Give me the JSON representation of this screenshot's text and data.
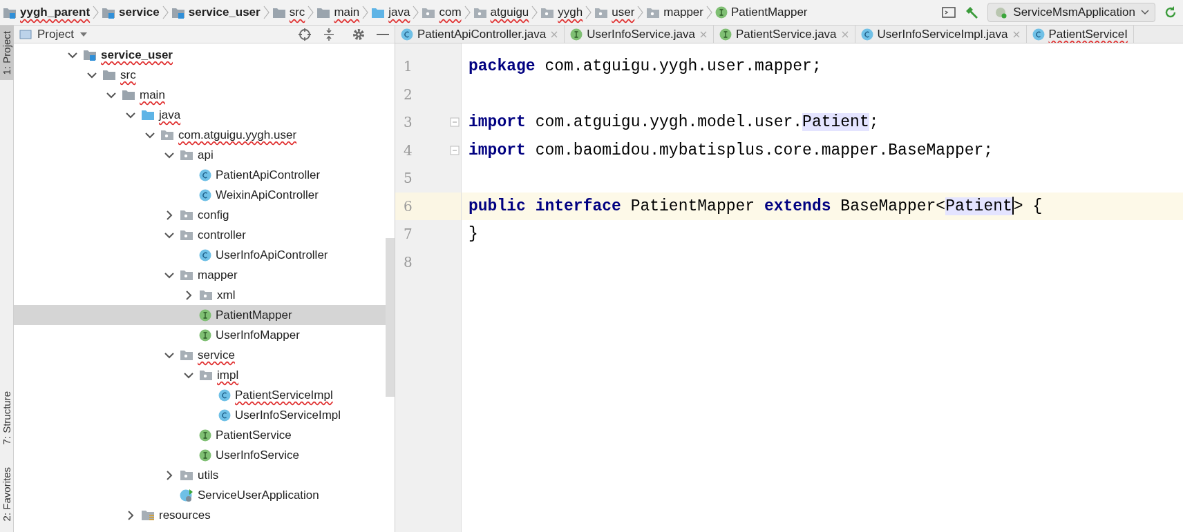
{
  "breadcrumbs": [
    {
      "label": "yygh_parent",
      "kind": "module",
      "spell_error": true
    },
    {
      "label": "service",
      "kind": "module",
      "spell_error": false
    },
    {
      "label": "service_user",
      "kind": "module",
      "spell_error": false
    },
    {
      "label": "src",
      "kind": "folder",
      "spell_error": true
    },
    {
      "label": "main",
      "kind": "folder",
      "spell_error": true
    },
    {
      "label": "java",
      "kind": "source",
      "spell_error": true
    },
    {
      "label": "com",
      "kind": "package",
      "spell_error": true
    },
    {
      "label": "atguigu",
      "kind": "package",
      "spell_error": true
    },
    {
      "label": "yygh",
      "kind": "package",
      "spell_error": true
    },
    {
      "label": "user",
      "kind": "package",
      "spell_error": true
    },
    {
      "label": "mapper",
      "kind": "package",
      "spell_error": false
    },
    {
      "label": "PatientMapper",
      "kind": "interface",
      "spell_error": false
    }
  ],
  "run_config": {
    "label": "ServiceMsmApplication"
  },
  "tool_stripe": [
    {
      "label": "1: Project",
      "selected": true
    },
    {
      "label": "7: Structure",
      "selected": false
    },
    {
      "label": "2: Favorites",
      "selected": false
    }
  ],
  "project_panel": {
    "title": "Project",
    "tree": [
      {
        "label": "service_user",
        "kind": "module",
        "bold": true,
        "spell_error": true,
        "expanded": true,
        "selected": false,
        "children": [
          {
            "label": "src",
            "kind": "folder",
            "spell_error": true,
            "expanded": true,
            "selected": false,
            "children": [
              {
                "label": "main",
                "kind": "folder",
                "spell_error": true,
                "expanded": true,
                "selected": false,
                "children": [
                  {
                    "label": "java",
                    "kind": "source",
                    "spell_error": true,
                    "expanded": true,
                    "selected": false,
                    "children": [
                      {
                        "label": "com.atguigu.yygh.user",
                        "kind": "package",
                        "spell_error": true,
                        "expanded": true,
                        "selected": false,
                        "children": [
                          {
                            "label": "api",
                            "kind": "package",
                            "spell_error": false,
                            "expanded": true,
                            "selected": false,
                            "children": [
                              {
                                "label": "PatientApiController",
                                "kind": "class",
                                "spell_error": false,
                                "selected": false
                              },
                              {
                                "label": "WeixinApiController",
                                "kind": "class",
                                "spell_error": false,
                                "selected": false
                              }
                            ]
                          },
                          {
                            "label": "config",
                            "kind": "package",
                            "spell_error": false,
                            "expanded": false,
                            "selected": false
                          },
                          {
                            "label": "controller",
                            "kind": "package",
                            "spell_error": false,
                            "expanded": true,
                            "selected": false,
                            "children": [
                              {
                                "label": "UserInfoApiController",
                                "kind": "class",
                                "spell_error": false,
                                "selected": false
                              }
                            ]
                          },
                          {
                            "label": "mapper",
                            "kind": "package",
                            "spell_error": false,
                            "expanded": true,
                            "selected": false,
                            "children": [
                              {
                                "label": "xml",
                                "kind": "package",
                                "spell_error": false,
                                "expanded": false,
                                "selected": false
                              },
                              {
                                "label": "PatientMapper",
                                "kind": "interface",
                                "spell_error": false,
                                "selected": true
                              },
                              {
                                "label": "UserInfoMapper",
                                "kind": "interface",
                                "spell_error": false,
                                "selected": false
                              }
                            ]
                          },
                          {
                            "label": "service",
                            "kind": "package",
                            "spell_error": true,
                            "expanded": true,
                            "selected": false,
                            "children": [
                              {
                                "label": "impl",
                                "kind": "package",
                                "spell_error": true,
                                "expanded": true,
                                "selected": false,
                                "children": [
                                  {
                                    "label": "PatientServiceImpl",
                                    "kind": "class",
                                    "spell_error": true,
                                    "selected": false
                                  },
                                  {
                                    "label": "UserInfoServiceImpl",
                                    "kind": "class",
                                    "spell_error": false,
                                    "selected": false
                                  }
                                ]
                              },
                              {
                                "label": "PatientService",
                                "kind": "interface",
                                "spell_error": false,
                                "selected": false
                              },
                              {
                                "label": "UserInfoService",
                                "kind": "interface",
                                "spell_error": false,
                                "selected": false
                              }
                            ]
                          },
                          {
                            "label": "utils",
                            "kind": "package",
                            "spell_error": false,
                            "expanded": false,
                            "selected": false
                          },
                          {
                            "label": "ServiceUserApplication",
                            "kind": "app",
                            "spell_error": false,
                            "selected": false
                          }
                        ]
                      }
                    ]
                  },
                  {
                    "label": "resources",
                    "kind": "resources",
                    "spell_error": false,
                    "expanded": false,
                    "selected": false
                  }
                ]
              }
            ]
          }
        ]
      }
    ]
  },
  "editor_tabs": [
    {
      "label": "PatientApiController.java",
      "kind": "class",
      "selected": false,
      "spell_error": false,
      "closable": true
    },
    {
      "label": "UserInfoService.java",
      "kind": "interface",
      "selected": false,
      "spell_error": false,
      "closable": true
    },
    {
      "label": "PatientService.java",
      "kind": "interface",
      "selected": false,
      "spell_error": false,
      "closable": true
    },
    {
      "label": "UserInfoServiceImpl.java",
      "kind": "class",
      "selected": false,
      "spell_error": false,
      "closable": true
    },
    {
      "label": "PatientServiceI",
      "kind": "class",
      "selected": false,
      "spell_error": true,
      "closable": false
    }
  ],
  "code_lines": [
    {
      "number": "1",
      "current": false,
      "fold": false,
      "tokens": [
        {
          "text": "package",
          "kind": "keyword"
        },
        {
          "text": " com.atguigu.yygh.user.mapper;",
          "kind": "plain"
        }
      ]
    },
    {
      "number": "2",
      "current": false,
      "fold": false
    },
    {
      "number": "3",
      "current": false,
      "fold": true,
      "tokens": [
        {
          "text": "import",
          "kind": "keyword"
        },
        {
          "text": " com.atguigu.yygh.model.user.",
          "kind": "plain"
        },
        {
          "text": "Patient",
          "kind": "usage"
        },
        {
          "text": ";",
          "kind": "plain"
        }
      ]
    },
    {
      "number": "4",
      "current": false,
      "fold": true,
      "tokens": [
        {
          "text": "import",
          "kind": "keyword"
        },
        {
          "text": " com.baomidou.mybatisplus.core.mapper.BaseMapper;",
          "kind": "plain"
        }
      ]
    },
    {
      "number": "5",
      "current": false,
      "fold": false
    },
    {
      "number": "6",
      "current": true,
      "fold": false,
      "tokens": [
        {
          "text": "public",
          "kind": "keyword"
        },
        {
          "text": " interface",
          "kind": "keyword"
        },
        {
          "text": " PatientMapper ",
          "kind": "plain"
        },
        {
          "text": "extends",
          "kind": "keyword"
        },
        {
          "text": " BaseMapper<",
          "kind": "plain"
        },
        {
          "text": "Patient",
          "kind": "usage",
          "caret_after": true
        },
        {
          "text": "> {",
          "kind": "plain"
        }
      ]
    },
    {
      "number": "7",
      "current": false,
      "fold": false,
      "tokens": [
        {
          "text": "}",
          "kind": "plain"
        }
      ]
    },
    {
      "number": "8",
      "current": false,
      "fold": false
    }
  ]
}
